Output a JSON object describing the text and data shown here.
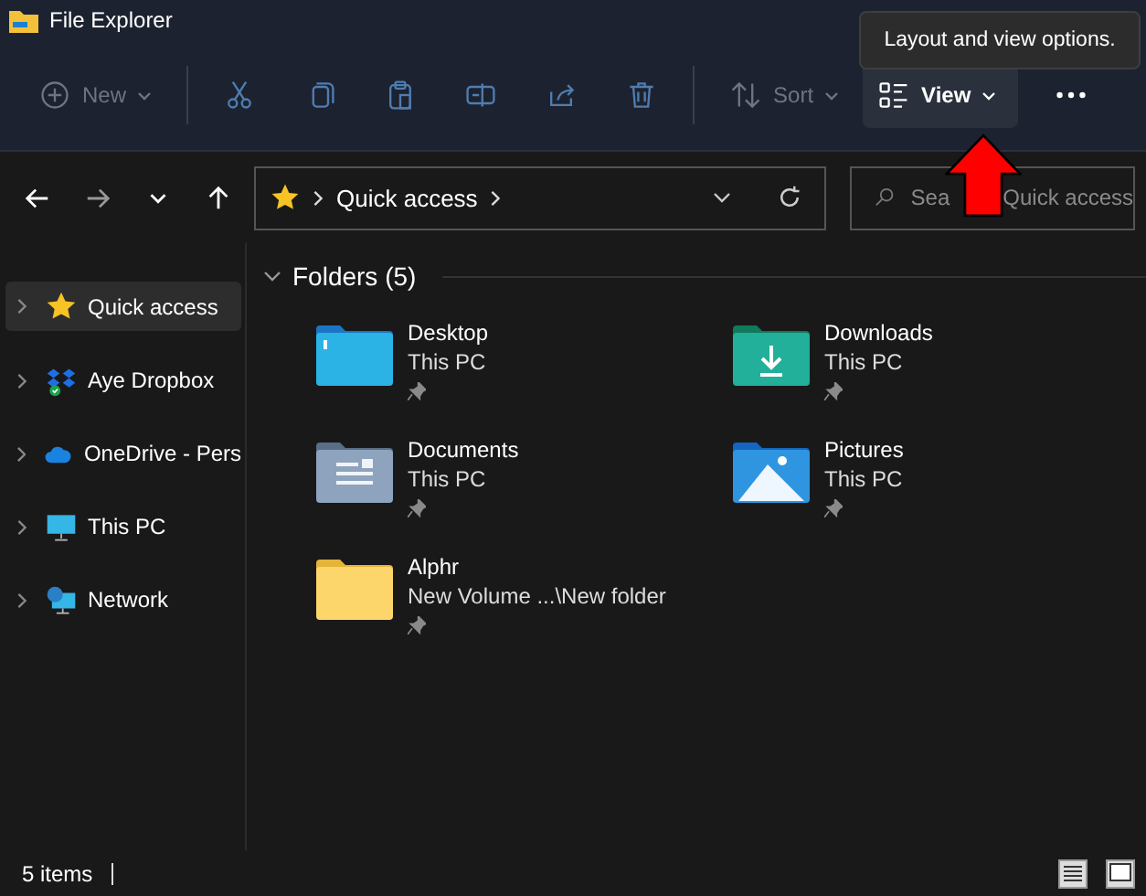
{
  "window": {
    "title": "File Explorer"
  },
  "toolbar": [
    {
      "kind": "new",
      "label": "New",
      "disabled": true,
      "highlighted": false
    },
    {
      "kind": "cut",
      "disabled": true,
      "highlighted": false
    },
    {
      "kind": "copy",
      "disabled": true,
      "highlighted": false
    },
    {
      "kind": "paste",
      "disabled": true,
      "highlighted": false
    },
    {
      "kind": "rename",
      "disabled": true,
      "highlighted": false
    },
    {
      "kind": "share",
      "disabled": true,
      "highlighted": false
    },
    {
      "kind": "delete",
      "disabled": true,
      "highlighted": false
    },
    {
      "kind": "sort",
      "label": "Sort",
      "disabled": true,
      "highlighted": false
    },
    {
      "kind": "view",
      "label": "View",
      "disabled": false,
      "highlighted": true
    },
    {
      "kind": "more",
      "disabled": false,
      "highlighted": false
    }
  ],
  "tooltip": "Layout and view options.",
  "nav": [
    {
      "kind": "back",
      "disabled": false
    },
    {
      "kind": "forward",
      "disabled": true
    },
    {
      "kind": "recent",
      "disabled": false
    },
    {
      "kind": "up",
      "disabled": false
    }
  ],
  "address": {
    "path": [
      "Quick access"
    ]
  },
  "search": {
    "visible_text": [
      "Sea",
      "Quick access"
    ]
  },
  "sidebar": [
    {
      "kind": "star",
      "label": "Quick access",
      "selected": true
    },
    {
      "kind": "dropbox",
      "label": "Aye Dropbox",
      "selected": false
    },
    {
      "kind": "cloud",
      "label": "OneDrive - Pers",
      "selected": false
    },
    {
      "kind": "pc",
      "label": "This PC",
      "selected": false
    },
    {
      "kind": "network",
      "label": "Network",
      "selected": false
    }
  ],
  "section": {
    "title": "Folders (5)",
    "expanded": true
  },
  "folders": [
    {
      "kind": "desktop",
      "name": "Desktop",
      "location": "This PC",
      "pinned": true
    },
    {
      "kind": "downloads",
      "name": "Downloads",
      "location": "This PC",
      "pinned": true
    },
    {
      "kind": "documents",
      "name": "Documents",
      "location": "This PC",
      "pinned": true
    },
    {
      "kind": "pictures",
      "name": "Pictures",
      "location": "This PC",
      "pinned": true
    },
    {
      "kind": "plain",
      "name": "Alphr",
      "location": "New Volume ...\\New folder",
      "pinned": true
    }
  ],
  "status": {
    "count": "5 items"
  }
}
